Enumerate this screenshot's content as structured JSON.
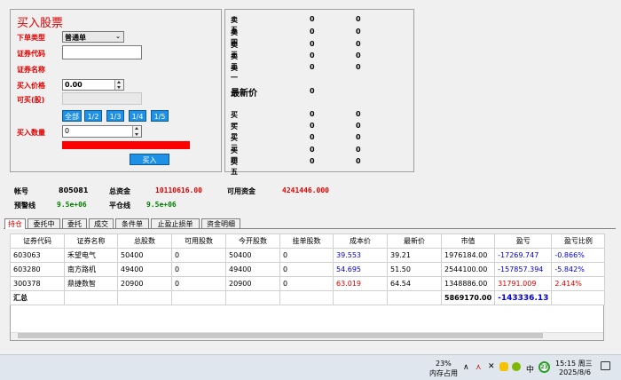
{
  "order_panel": {
    "title": "买入股票",
    "order_type_label": "下单类型",
    "order_type_value": "普通单",
    "code_label": "证券代码",
    "code_value": "",
    "name_label": "证券名称",
    "price_label": "买入价格",
    "price_value": "0.00",
    "available_label": "可买(股)",
    "available_value": "",
    "quick_buttons": [
      "全部",
      "1/2",
      "1/3",
      "1/4",
      "1/5"
    ],
    "qty_label": "买入数量",
    "qty_value": "0",
    "buy_button": "买入",
    "progress_color": "#ff0000"
  },
  "order_book": {
    "sells": [
      {
        "label": "卖五",
        "price": "0",
        "volume": "0"
      },
      {
        "label": "卖四",
        "price": "0",
        "volume": "0"
      },
      {
        "label": "卖三",
        "price": "0",
        "volume": "0"
      },
      {
        "label": "卖二",
        "price": "0",
        "volume": "0"
      },
      {
        "label": "卖一",
        "price": "0",
        "volume": "0"
      }
    ],
    "last_price_label": "最新价",
    "last_price_value": "0",
    "buys": [
      {
        "label": "买一",
        "price": "0",
        "volume": "0"
      },
      {
        "label": "买二",
        "price": "0",
        "volume": "0"
      },
      {
        "label": "买三",
        "price": "0",
        "volume": "0"
      },
      {
        "label": "买四",
        "price": "0",
        "volume": "0"
      },
      {
        "label": "买五",
        "price": "0",
        "volume": "0"
      }
    ]
  },
  "account": {
    "account_label": "帐号",
    "account_value": "805081",
    "total_label": "总资金",
    "total_value": "10110616.00",
    "available_label": "可用资金",
    "available_value": "4241446.000",
    "warning_label": "预警线",
    "warning_value": "9.5e+06",
    "close_label": "平仓线",
    "close_value": "9.5e+06"
  },
  "tabs": [
    "持仓",
    "委托中",
    "委托",
    "成交",
    "条件单",
    "止盈止损单",
    "资金明细"
  ],
  "positions": {
    "headers": [
      "证券代码",
      "证券名称",
      "总股数",
      "可用股数",
      "今开股数",
      "挂单股数",
      "成本价",
      "最新价",
      "市值",
      "盈亏",
      "盈亏比例"
    ],
    "rows": [
      [
        "603063",
        "禾望电气",
        "50400",
        "0",
        "50400",
        "0",
        "39.553",
        "39.21",
        "1976184.00",
        "-17269.747",
        "-0.866%"
      ],
      [
        "603280",
        "南方路机",
        "49400",
        "0",
        "49400",
        "0",
        "54.695",
        "51.50",
        "2544100.00",
        "-157857.394",
        "-5.842%"
      ],
      [
        "300378",
        "鼎捷数智",
        "20900",
        "0",
        "20900",
        "0",
        "63.019",
        "64.54",
        "1348886.00",
        "31791.009",
        "2.414%"
      ]
    ],
    "summary_label": "汇总",
    "summary_value": "5869170.00",
    "summary_pnl": "-143336.13"
  },
  "taskbar": {
    "memory_percent": "23%",
    "memory_label": "内存占用",
    "badge": "23",
    "ime": "中",
    "time": "15:15 周三",
    "date": "2025/8/6"
  }
}
